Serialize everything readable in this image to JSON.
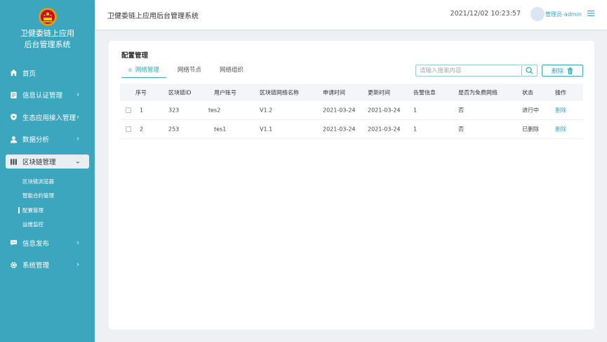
{
  "sidebar": {
    "title_line1": "卫健委链上应用",
    "title_line2": "后台管理系统",
    "items": [
      {
        "label": "首页",
        "icon": "home-icon",
        "chevron": ""
      },
      {
        "label": "信息认证管理",
        "icon": "id-card-icon",
        "chevron": "›"
      },
      {
        "label": "生态应用接入管理",
        "icon": "shield-icon",
        "chevron": "›"
      },
      {
        "label": "数据分析",
        "icon": "user-icon",
        "chevron": "›"
      }
    ],
    "active_item": {
      "label": "区块链管理",
      "icon": "bars-icon",
      "chevron": "⌄"
    },
    "sub_items": [
      {
        "label": "区块链浏览器"
      },
      {
        "label": "智能合约管理"
      },
      {
        "label": "配置管理"
      },
      {
        "label": "运维监控"
      }
    ],
    "bottom_items": [
      {
        "label": "信息发布",
        "icon": "chat-icon",
        "chevron": "›"
      },
      {
        "label": "系统管理",
        "icon": "gear-icon",
        "chevron": "›"
      }
    ]
  },
  "header": {
    "title": "卫健委链上应用后台管理系统",
    "datetime": "2021/12/02 10:23:57",
    "user": "管理员-admin"
  },
  "card": {
    "title": "配置管理",
    "tabs": [
      {
        "label": "网络管理"
      },
      {
        "label": "网络节点"
      },
      {
        "label": "网络组织"
      }
    ],
    "search_placeholder": "请输入搜索内容",
    "delete_label": "删除"
  },
  "table": {
    "columns": [
      "序号",
      "区块链ID",
      "用户账号",
      "区块链网络名称",
      "申请时间",
      "更新时间",
      "告警信息",
      "是否为免费网络",
      "状态",
      "操作"
    ],
    "rows": [
      {
        "no": "1",
        "chain_id": "323",
        "account": "tes2",
        "network": "V1.2",
        "apply": "2021-03-24",
        "update": "2021-03-24",
        "alarm": "1",
        "free": "否",
        "status": "进行中",
        "action": "删除"
      },
      {
        "no": "2",
        "chain_id": "253",
        "account": "tes1",
        "network": "V1.1",
        "apply": "2021-03-24",
        "update": "2021-03-24",
        "alarm": "1",
        "free": "否",
        "status": "已删除",
        "action": "删除"
      }
    ]
  },
  "colors": {
    "accent": "#3ba6be",
    "sidebar_bg": "#3ba6be",
    "page_bg": "#eef0f3"
  }
}
